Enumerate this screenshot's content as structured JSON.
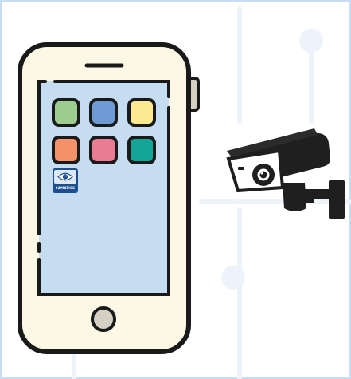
{
  "app_icon": {
    "label": "CAMATICS",
    "icon": "eye-icon"
  },
  "colors": {
    "frame_border": "#c9dcf6",
    "phone_body": "#fdf8e6",
    "phone_outline": "#1a1a1a",
    "phone_screen": "#c5dcf1",
    "app_green": "#9ccc8f",
    "app_blue": "#6e9bd4",
    "app_yellow": "#fbea8f",
    "app_orange": "#f4906a",
    "app_pink": "#e97b92",
    "app_teal": "#13a597",
    "camera_body": "#1f1f1f",
    "camera_lens_ring": "#ffffff",
    "background_pattern": "#eef3fb"
  },
  "icons": [
    "smartphone-icon",
    "security-camera-icon"
  ]
}
